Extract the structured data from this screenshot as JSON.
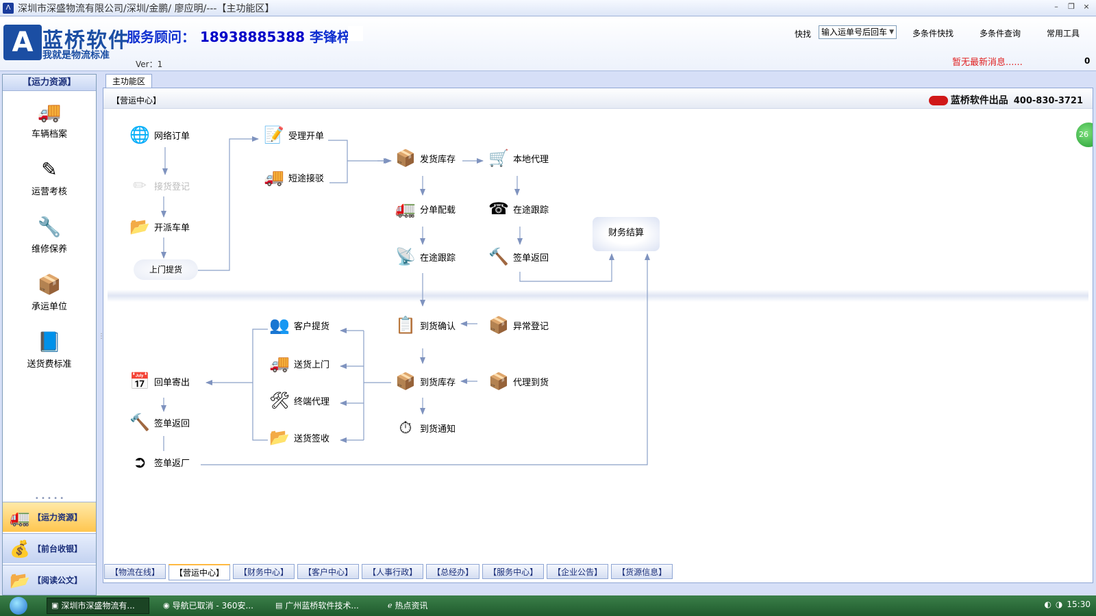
{
  "window": {
    "title": "深圳市深盛物流有限公司/深圳/金鹏/ 廖应明/---【主功能区】",
    "controls": [
      "–",
      "❐",
      "×"
    ]
  },
  "header": {
    "logo_icon_letter": "A",
    "logo_text": "蓝桥软件",
    "logo_slogan": "我就是物流标准",
    "consultant_label": "服务顾问：",
    "consultant_phone": "18938885388",
    "consultant_name": "李锋梓",
    "version": "Ver：1",
    "quick_label": "快找",
    "quick_placeholder": "输入运单号后回车",
    "links": [
      "多条件快找",
      "多条件查询",
      "常用工具"
    ],
    "news": "暂无最新消息......",
    "count": "0"
  },
  "sidebar": {
    "title": "【运力资源】",
    "items": [
      {
        "label": "车辆档案",
        "icon": "truck-icon",
        "glyph": "🚚"
      },
      {
        "label": "运营考核",
        "icon": "pencil-icon",
        "glyph": "✎"
      },
      {
        "label": "维修保养",
        "icon": "wrench-icon",
        "glyph": "🔧"
      },
      {
        "label": "承运单位",
        "icon": "package-icon",
        "glyph": "📦"
      },
      {
        "label": "送货费标准",
        "icon": "book-icon",
        "glyph": "📘"
      }
    ],
    "nav": [
      {
        "label": "【运力资源】",
        "icon": "truck-icon",
        "glyph": "🚛",
        "active": true
      },
      {
        "label": "【前台收银】",
        "icon": "money-bag-icon",
        "glyph": "💰",
        "active": false
      },
      {
        "label": "【阅读公文】",
        "icon": "folder-icon",
        "glyph": "📂",
        "active": false
      }
    ]
  },
  "main": {
    "tab_label": "主功能区",
    "panel_title": "【营运中心】",
    "brand": "蓝桥软件出品",
    "brand_phone": "400-830-3721",
    "badge": "26"
  },
  "flow": {
    "nodes": [
      {
        "id": "n1",
        "label": "网络订单",
        "icon": "globe-icon",
        "glyph": "🌐"
      },
      {
        "id": "n2",
        "label": "接货登记",
        "icon": "pencil-icon",
        "glyph": "✏",
        "disabled": true
      },
      {
        "id": "n3",
        "label": "开派车单",
        "icon": "folder-icon",
        "glyph": "📂"
      },
      {
        "id": "n5",
        "label": "受理开单",
        "icon": "edit-icon",
        "glyph": "📝"
      },
      {
        "id": "n6",
        "label": "短途接驳",
        "icon": "truck-icon",
        "glyph": "🚚"
      },
      {
        "id": "n7",
        "label": "发货库存",
        "icon": "box-icon",
        "glyph": "📦"
      },
      {
        "id": "n8",
        "label": "本地代理",
        "icon": "hand-truck-icon",
        "glyph": "🛒"
      },
      {
        "id": "n9",
        "label": "分单配载",
        "icon": "lorry-icon",
        "glyph": "🚛"
      },
      {
        "id": "n10",
        "label": "在途跟踪",
        "icon": "phone-icon",
        "glyph": "☎"
      },
      {
        "id": "n11",
        "label": "在途跟踪",
        "icon": "satellite-icon",
        "glyph": "📡"
      },
      {
        "id": "n12",
        "label": "签单返回",
        "icon": "hammer-icon",
        "glyph": "🔨"
      },
      {
        "id": "n14",
        "label": "客户提货",
        "icon": "people-icon",
        "glyph": "👥"
      },
      {
        "id": "n15",
        "label": "送货上门",
        "icon": "van-icon",
        "glyph": "🚚"
      },
      {
        "id": "n16",
        "label": "终端代理",
        "icon": "pallet-jack-icon",
        "glyph": "🛠"
      },
      {
        "id": "n17",
        "label": "送货签收",
        "icon": "folder-icon",
        "glyph": "📂"
      },
      {
        "id": "n18",
        "label": "到货确认",
        "icon": "clipboard-check-icon",
        "glyph": "📋"
      },
      {
        "id": "n19",
        "label": "异常登记",
        "icon": "open-box-icon",
        "glyph": "📦"
      },
      {
        "id": "n20",
        "label": "到货库存",
        "icon": "box-icon",
        "glyph": "📦"
      },
      {
        "id": "n21",
        "label": "代理到货",
        "icon": "box-icon",
        "glyph": "📦"
      },
      {
        "id": "n22",
        "label": "到货通知",
        "icon": "stopwatch-icon",
        "glyph": "⏱"
      },
      {
        "id": "n23",
        "label": "回单寄出",
        "icon": "calendar-clock-icon",
        "glyph": "📅"
      },
      {
        "id": "n24",
        "label": "签单返回",
        "icon": "hammer-icon",
        "glyph": "🔨"
      },
      {
        "id": "n25",
        "label": "签单返厂",
        "icon": "arrow-circle-icon",
        "glyph": "➲"
      }
    ],
    "pickup_label": "上门提货",
    "finance_label": "财务结算"
  },
  "bottom_tabs": [
    "【物流在线】",
    "【营运中心】",
    "【财务中心】",
    "【客户中心】",
    "【人事行政】",
    "【总经办】",
    "【服务中心】",
    "【企业公告】",
    "【货源信息】"
  ],
  "bottom_tab_active": "【营运中心】",
  "taskbar": {
    "tasks": [
      "深圳市深盛物流有...",
      "导航已取消 - 360安...",
      "广州蓝桥软件技术...",
      "热点资讯"
    ],
    "task_icons": [
      "app-icon",
      "browser-icon",
      "folder-icon",
      "ie-icon"
    ],
    "active_task": "深圳市深盛物流有...",
    "time": "15:30"
  },
  "colors": {
    "accent": "#1b4ea3",
    "consultant": "#1030d0",
    "news": "#e02020",
    "taskbar": "#2a6b38",
    "active_nav": "#ffc64f"
  }
}
